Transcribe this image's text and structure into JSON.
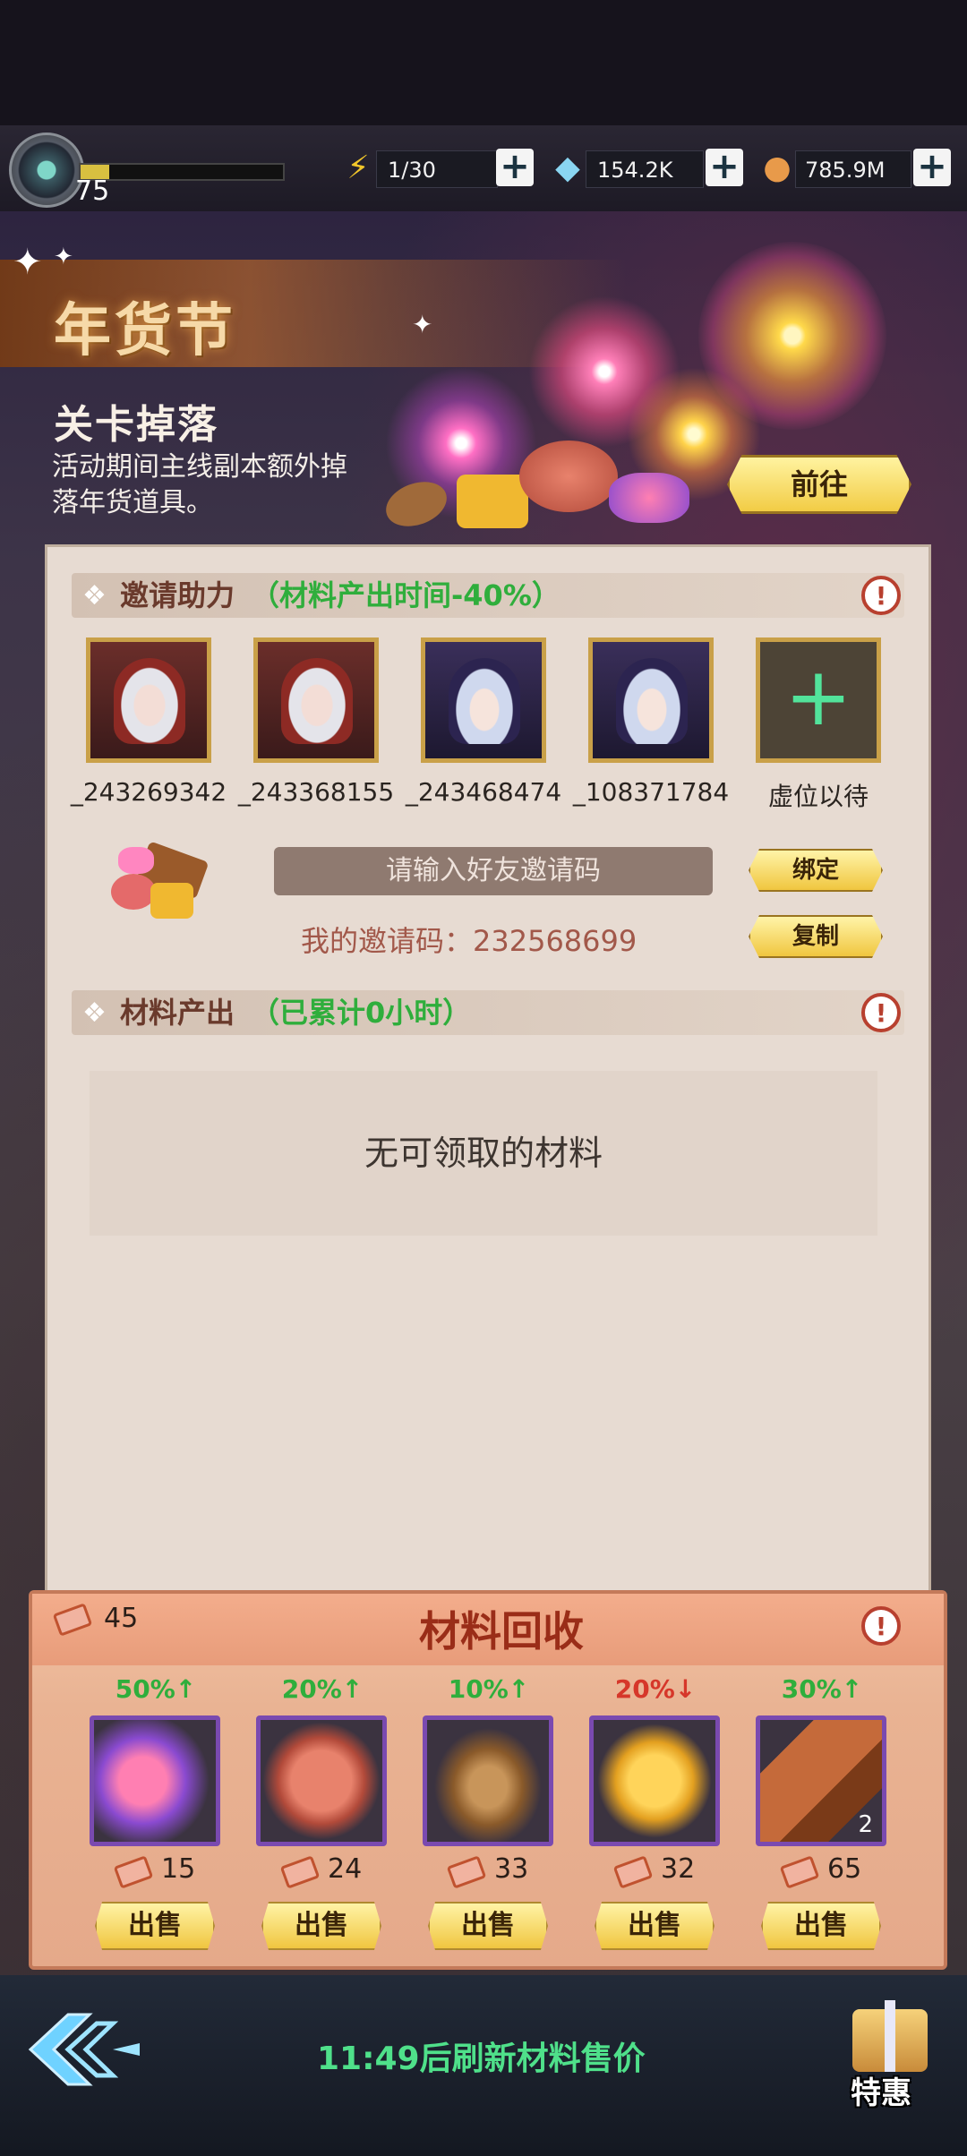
{
  "topbar": {
    "level": "75",
    "exp_fraction": 0.14,
    "stamina": "1/30",
    "diamonds": "154.2K",
    "coins": "785.9M"
  },
  "banner": {
    "title": "年货节",
    "stage_title": "关卡掉落",
    "stage_desc": "活动期间主线副本额外掉落年货道具。",
    "goto_label": "前往"
  },
  "invite": {
    "section_label": "邀请助力",
    "section_sub": "（材料产出时间-40%）",
    "helpers": [
      {
        "name": "_243269342",
        "type": "red-hood"
      },
      {
        "name": "_243368155",
        "type": "red-hood"
      },
      {
        "name": "_243468474",
        "type": "witch"
      },
      {
        "name": "_108371784",
        "type": "witch"
      }
    ],
    "empty_slot_label": "虚位以待",
    "code_placeholder": "请输入好友邀请码",
    "bind_label": "绑定",
    "copy_label": "复制",
    "my_code": "我的邀请码：232568699"
  },
  "output": {
    "section_label": "材料产出",
    "section_sub": "（已累计0小时）",
    "empty_message": "无可领取的材料"
  },
  "recycle": {
    "title": "材料回收",
    "tickets": "45",
    "items": [
      {
        "pct": "50%↑",
        "trend": "up",
        "price": "15",
        "icon": "candy-icon",
        "count": ""
      },
      {
        "pct": "20%↑",
        "trend": "up",
        "price": "24",
        "icon": "macaron-icon",
        "count": ""
      },
      {
        "pct": "10%↑",
        "trend": "up",
        "price": "33",
        "icon": "almond-icon",
        "count": ""
      },
      {
        "pct": "20%↓",
        "trend": "down",
        "price": "32",
        "icon": "honeycomb-icon",
        "count": ""
      },
      {
        "pct": "30%↑",
        "trend": "up",
        "price": "65",
        "icon": "chocolate-icon",
        "count": "2"
      }
    ],
    "sell_label": "出售"
  },
  "bottom": {
    "refresh_text": "11:49后刷新材料售价",
    "special_label": "特惠"
  },
  "colors": {
    "up": "#2fae3c",
    "down": "#d6372a",
    "accent_gold": "#f0c63f",
    "panel": "#e7dbd2"
  }
}
